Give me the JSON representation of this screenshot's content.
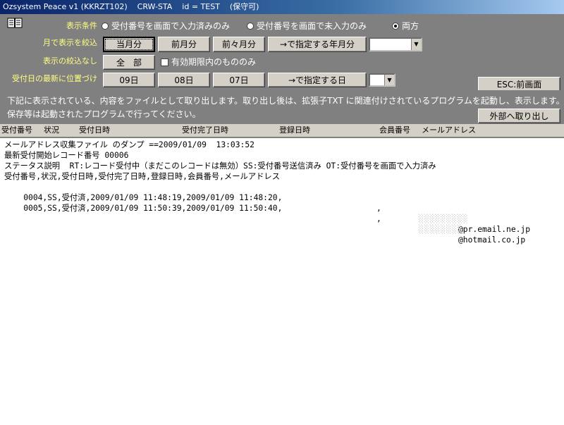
{
  "window": {
    "title": "Ozsystem Peace v1 (KKRZT102)    CRW-STA    id = TEST    (保守可)"
  },
  "row1": {
    "label": "表示条件",
    "options": [
      {
        "label": "受付番号を画面で入力済みのみ"
      },
      {
        "label": "受付番号を画面で未入力のみ"
      },
      {
        "label": "両方"
      }
    ]
  },
  "row2": {
    "label": "月で表示を絞込",
    "buttons": [
      "当月分",
      "前月分",
      "前々月分",
      "→で指定する年月分"
    ]
  },
  "row3": {
    "label": "表示の絞込なし",
    "button": "全　部",
    "checkbox_label": "有効期限内のもののみ"
  },
  "row4": {
    "label": "受付日の最新に位置づけ",
    "buttons": [
      "09日",
      "08日",
      "07日",
      "→で指定する日"
    ]
  },
  "esc_button": "ESC:前画面",
  "description": {
    "line1": "下記に表示されている、内容をファイルとして取り出します。取り出し後は、拡張子TXT に関連付けされているプログラムを起動し、表示します。",
    "line2": "保存等は起動されたプログラムで行ってください。",
    "export_button": "外部へ取り出し"
  },
  "columns": [
    "受付番号",
    "状況",
    "受付日時",
    "受付完了日時",
    "登録日時",
    "会員番号",
    "メールアドレス"
  ],
  "content": {
    "lines": [
      "メールアドレス収集ファイル のダンプ ==2009/01/09  13:03:52",
      "最新受付開始レコード番号 00006",
      "ステータス説明  RT:レコード受付中（まだこのレコードは無効）SS:受付番号送信済み OT:受付番号を画面で入力済み",
      "受付番号,状況,受付日時,受付完了日時,登録日時,会員番号,メールアドレス"
    ],
    "records": [
      {
        "text": "0004,SS,受付済,2009/01/09 11:48:19,2009/01/09 11:48:20,",
        "sep": ",",
        "email": "@pr.email.ne.jp"
      },
      {
        "text": "0005,SS,受付済,2009/01/09 11:50:39,2009/01/09 11:50:40,",
        "sep": ",",
        "email": "@hotmail.co.jp"
      }
    ]
  }
}
